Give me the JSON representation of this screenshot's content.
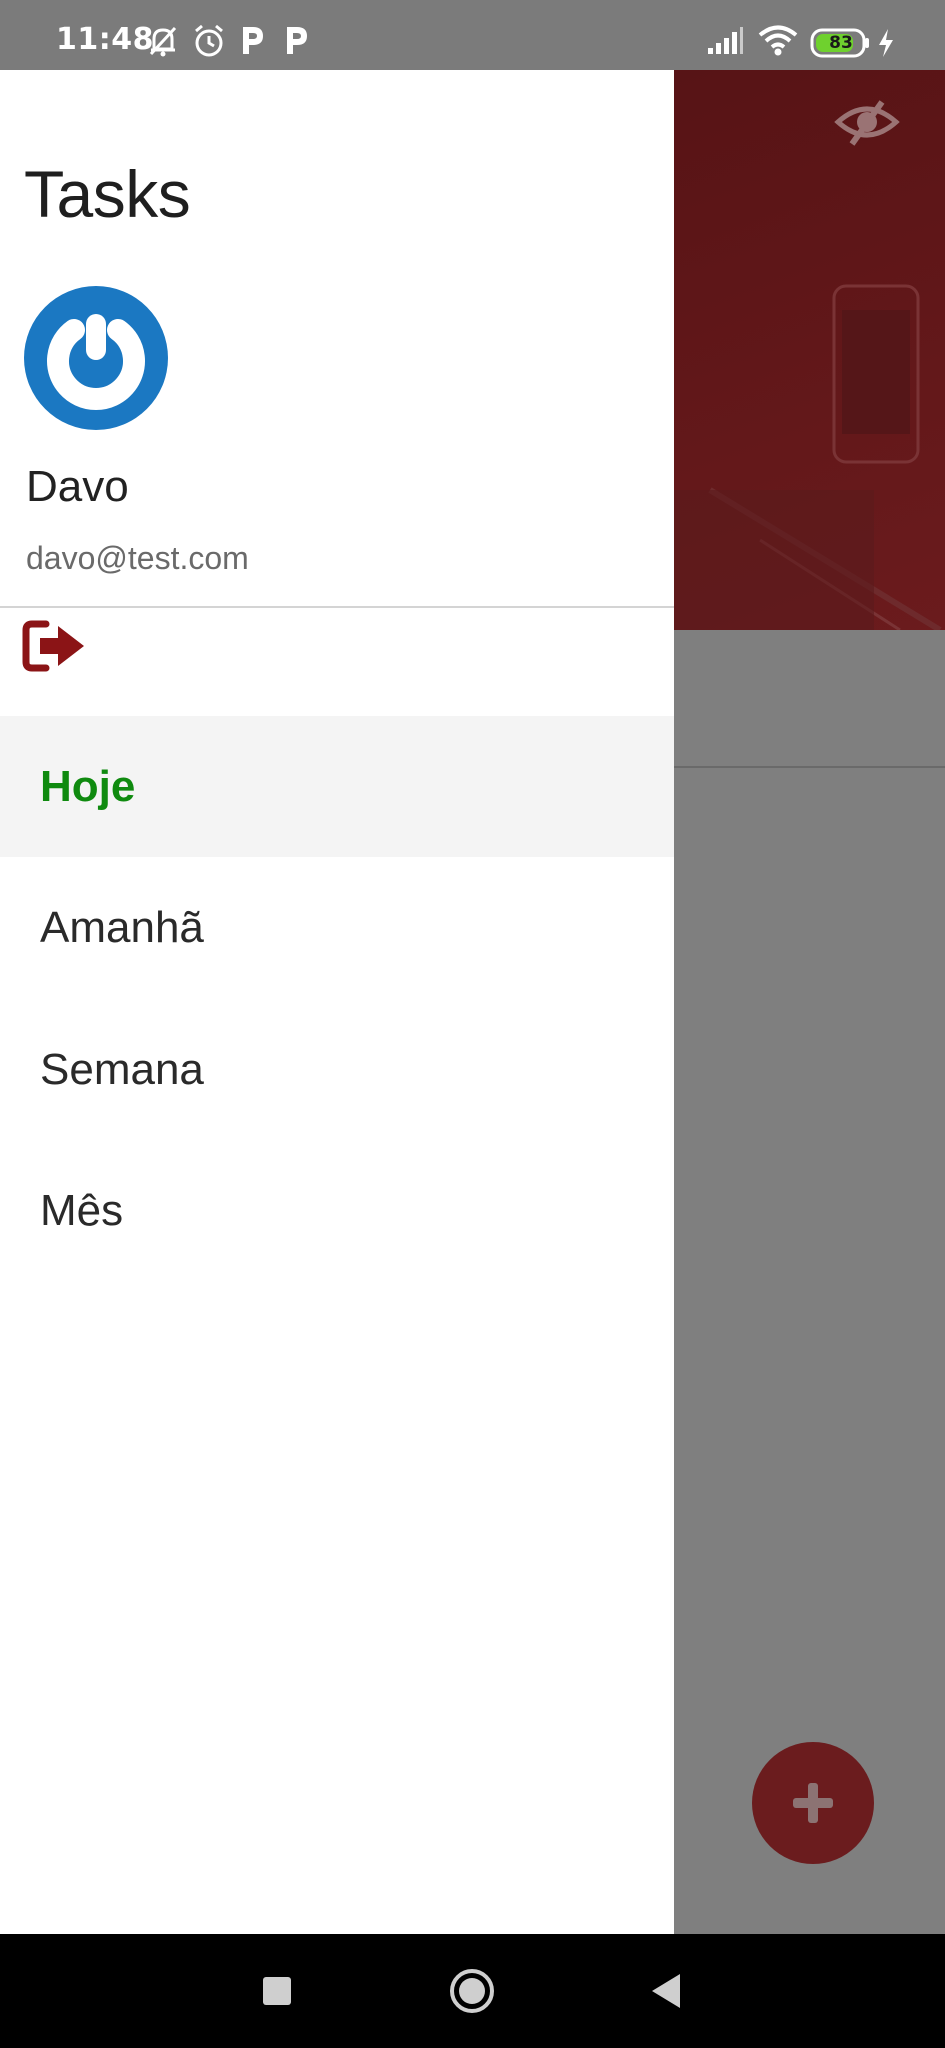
{
  "status_bar": {
    "time": "11:48",
    "battery_level": "83",
    "icons": [
      "mute-bell-icon",
      "alarm-icon",
      "p-notification-icon",
      "p-notification-icon",
      "signal-icon",
      "wifi-icon",
      "battery-icon",
      "charging-icon"
    ]
  },
  "drawer": {
    "title": "Tasks",
    "user": {
      "name": "Davo",
      "email": "davo@test.com"
    },
    "menu": [
      {
        "label": "Hoje",
        "selected": true
      },
      {
        "label": "Amanhã",
        "selected": false
      },
      {
        "label": "Semana",
        "selected": false
      },
      {
        "label": "Mês",
        "selected": false
      }
    ]
  },
  "colors": {
    "accent_green": "#0f8a0f",
    "brand_red": "#8b1416",
    "avatar_blue": "#1b78c2"
  },
  "background_app": {
    "icons": [
      "eye-off-icon",
      "plus-icon"
    ]
  },
  "nav_bar": {
    "icons": [
      "recents-square-icon",
      "home-circle-icon",
      "back-triangle-icon"
    ]
  }
}
